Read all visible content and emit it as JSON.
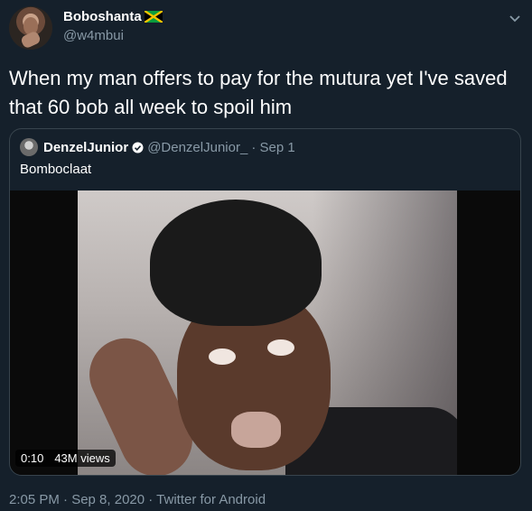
{
  "tweet": {
    "display_name": "Boboshanta",
    "flag_icon": "jamaica-flag-icon",
    "handle": "@w4mbui",
    "text": "When my man offers to pay for the mutura yet I've saved that 60 bob all week to spoil him",
    "footer": "2:05 PM · Sep 8, 2020 · Twitter for Android"
  },
  "quote": {
    "display_name": "DenzelJunior",
    "handle": "@DenzelJunior_",
    "date": "· Sep 1",
    "text": "Bomboclaat",
    "video": {
      "time": "0:10",
      "views": "43M views"
    }
  },
  "colors": {
    "background": "#15202b",
    "border": "#38444d",
    "muted": "#8899a6"
  }
}
